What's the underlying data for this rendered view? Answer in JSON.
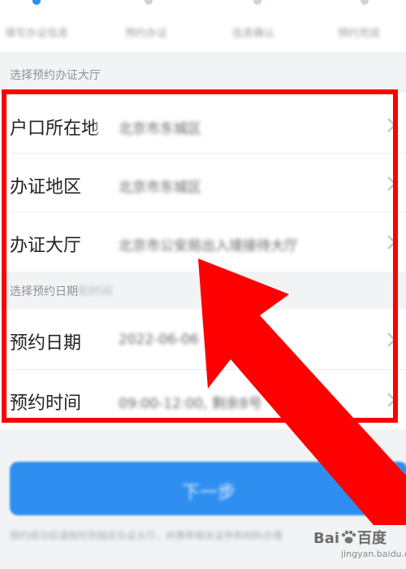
{
  "steps": [
    {
      "label": "填写办证信息",
      "active": true
    },
    {
      "label": "预约办证",
      "active": false
    },
    {
      "label": "信息确认",
      "active": false
    },
    {
      "label": "预约完成",
      "active": false
    }
  ],
  "sections": {
    "hall_title": "选择预约办证大厅",
    "date_title": "选择预约日期",
    "date_title_extra": "和时间"
  },
  "rows": [
    {
      "label": "户口所在地",
      "value": "北京市东城区"
    },
    {
      "label": "办证地区",
      "value": "北京市东城区"
    },
    {
      "label": "办证大厅",
      "value": "北京市公安局出入境接待大厅"
    },
    {
      "label": "预约日期",
      "value": "2022-06-06"
    },
    {
      "label": "预约时间",
      "value": "09:00-12:00, 剩余8号"
    }
  ],
  "next_button": {
    "label": "下一步"
  },
  "footnote": "预约成功后请按时到指定办证大厅，并携带相关证件和材料办理",
  "watermark": {
    "brand": "Bai",
    "brand_paw": "百度",
    "sub": "jingyan.baidu.com"
  },
  "colors": {
    "accent": "#2f8ff0",
    "highlight": "#ff0000"
  }
}
